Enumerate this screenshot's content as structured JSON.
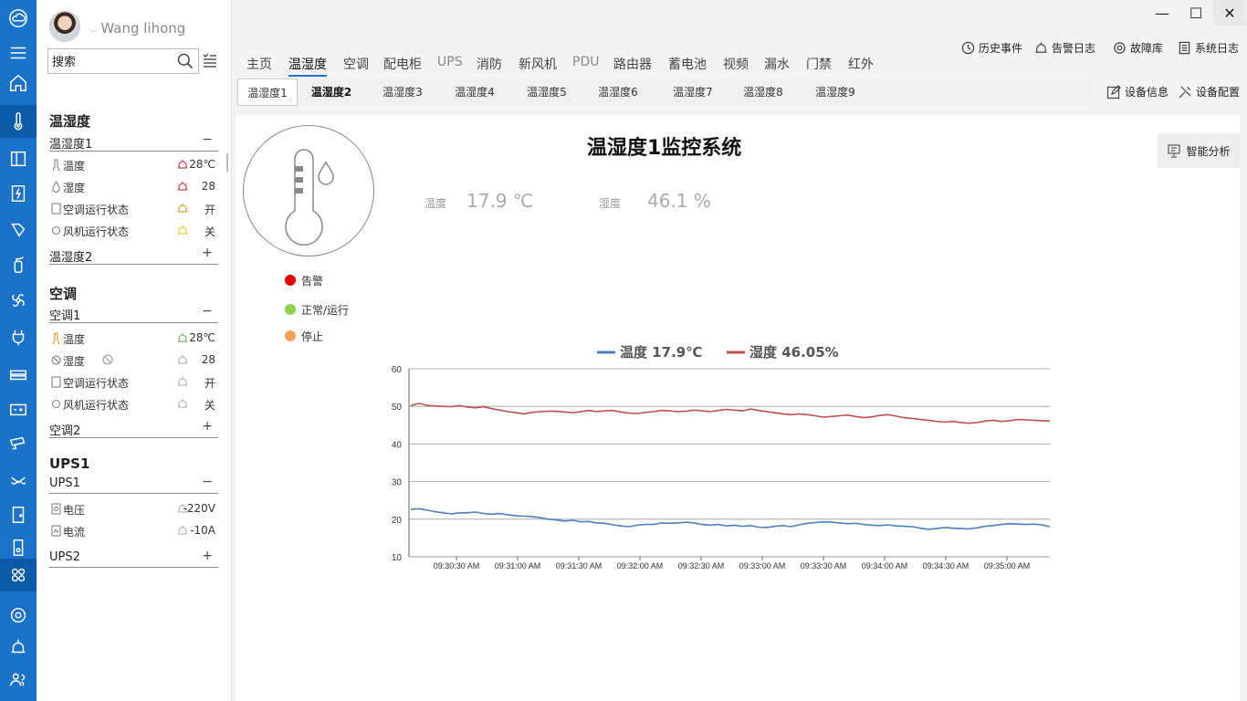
{
  "user": {
    "name": "Wang lihong"
  },
  "search": {
    "placeholder": "搜索"
  },
  "rail_icons": [
    "cloud-icon",
    "menu-icon",
    "home-icon",
    "thermometer-icon",
    "cabinet-icon",
    "power-icon",
    "fire-icon",
    "extinguisher-icon",
    "fan-icon",
    "plug-icon",
    "router-icon",
    "battery-icon",
    "camera-icon",
    "water-leak-icon",
    "door-icon",
    "ups-icon",
    "airflow-icon",
    "settings-icon",
    "alarm-icon",
    "users-icon"
  ],
  "tree": {
    "sections": [
      {
        "title": "温湿度",
        "groups": [
          {
            "name": "温湿度1",
            "toggle": "−",
            "rows": [
              {
                "label": "温度",
                "value": "28℃"
              },
              {
                "label": "湿度",
                "value": "28"
              },
              {
                "label": "空调运行状态",
                "value": "开"
              },
              {
                "label": "风机运行状态",
                "value": "关"
              }
            ]
          },
          {
            "name": "温湿度2",
            "toggle": "+"
          }
        ]
      },
      {
        "title": "空调",
        "groups": [
          {
            "name": "空调1",
            "toggle": "−",
            "rows": [
              {
                "label": "温度",
                "value": "28℃"
              },
              {
                "label": "湿度",
                "value": "28"
              },
              {
                "label": "空调运行状态",
                "value": "开"
              },
              {
                "label": "风机运行状态",
                "value": "关"
              }
            ]
          },
          {
            "name": "空调2",
            "toggle": "+"
          }
        ]
      },
      {
        "title": "UPS1",
        "groups": [
          {
            "name": "UPS1",
            "toggle": "−",
            "rows": [
              {
                "label": "电压",
                "value": "-220V"
              },
              {
                "label": "电流",
                "value": "-10A"
              }
            ]
          },
          {
            "name": "UPS2",
            "toggle": "+"
          }
        ]
      }
    ]
  },
  "window": {
    "minimize": "—",
    "maximize": "☐",
    "close": "✕"
  },
  "top_actions": {
    "history": "历史事件",
    "alarm_log": "告警日志",
    "fault_lib": "故障库",
    "sys_log": "系统日志"
  },
  "nav_tabs": [
    "主页",
    "温湿度",
    "空调",
    "配电柜",
    "UPS",
    "消防",
    "新风机",
    "PDU",
    "路由器",
    "蓄电池",
    "视频",
    "漏水",
    "门禁",
    "红外"
  ],
  "sub_tabs": [
    "温湿度1",
    "温湿度2",
    "温湿度3",
    "温湿度4",
    "温湿度5",
    "温湿度6",
    "温湿度7",
    "温湿度8",
    "温湿度9"
  ],
  "device": {
    "info": "设备信息",
    "config": "设备配置"
  },
  "panel": {
    "title": "温湿度1监控系统",
    "temp_label": "温度",
    "temp_value": "17.9 ℃",
    "hum_label": "湿度",
    "hum_value": "46.1 %",
    "smart_analysis": "智能分析",
    "status_legend": [
      {
        "label": "告警",
        "color": "#e60000"
      },
      {
        "label": "正常/运行",
        "color": "#8fd14f"
      },
      {
        "label": "停止",
        "color": "#f5a05a"
      }
    ]
  },
  "colors": {
    "accent": "#1a73c9",
    "temp_series": "#4a7fc1",
    "hum_series": "#c0504d",
    "alarm_red": "#c02020",
    "alarm_orange": "#e08a00",
    "alarm_yellow": "#d8c000",
    "alarm_green": "#5aa845",
    "alarm_gray": "#aaaaaa"
  },
  "chart_data": {
    "type": "line",
    "legend": [
      "温度  17.9℃",
      "湿度  46.05%"
    ],
    "ylim": [
      10,
      60
    ],
    "yticks": [
      10,
      20,
      30,
      40,
      50,
      60
    ],
    "xticks": [
      "09:30:30 AM",
      "09:31:00 AM",
      "09:31:30 AM",
      "09:32:00 AM",
      "09:32:30 AM",
      "09:33:00 AM",
      "09:33:30 AM",
      "09:34:00 AM",
      "09:34:30 AM",
      "09:35:00 AM"
    ],
    "series": [
      {
        "name": "温度",
        "color": "#4a7fc1",
        "values": [
          22.6,
          22.8,
          22.4,
          22.0,
          21.7,
          21.4,
          21.7,
          21.7,
          21.9,
          21.5,
          21.3,
          21.5,
          21.2,
          20.9,
          20.8,
          20.7,
          20.4,
          20.0,
          19.8,
          19.5,
          19.7,
          19.3,
          19.4,
          19.0,
          18.9,
          18.5,
          18.2,
          18.0,
          18.4,
          18.6,
          18.6,
          19.0,
          18.9,
          19.0,
          19.2,
          19.0,
          18.6,
          18.4,
          18.6,
          18.2,
          18.4,
          18.1,
          18.3,
          17.9,
          17.8,
          18.1,
          18.3,
          18.0,
          18.5,
          18.9,
          19.1,
          19.3,
          19.2,
          19.0,
          18.8,
          18.9,
          18.6,
          18.4,
          18.3,
          18.5,
          18.2,
          18.1,
          18.0,
          17.6,
          17.3,
          17.5,
          17.8,
          17.6,
          17.5,
          17.4,
          17.7,
          18.1,
          18.3,
          18.6,
          18.8,
          18.7,
          18.6,
          18.7,
          18.5,
          18.0
        ]
      },
      {
        "name": "湿度",
        "color": "#c0504d",
        "values": [
          50.2,
          50.8,
          50.3,
          50.1,
          50.0,
          49.9,
          50.2,
          49.8,
          49.6,
          49.9,
          49.4,
          49.0,
          48.6,
          48.3,
          48.0,
          48.4,
          48.6,
          48.7,
          48.7,
          48.5,
          48.3,
          48.6,
          48.9,
          48.6,
          48.8,
          48.9,
          48.5,
          48.2,
          48.1,
          48.4,
          48.6,
          48.9,
          48.8,
          48.6,
          48.7,
          49.0,
          48.8,
          48.6,
          48.9,
          49.2,
          49.0,
          48.8,
          49.3,
          48.9,
          48.6,
          48.3,
          48.0,
          47.8,
          48.0,
          47.8,
          47.5,
          47.1,
          47.3,
          47.5,
          47.7,
          47.3,
          47.0,
          47.2,
          47.6,
          47.8,
          47.4,
          47.0,
          46.8,
          46.5,
          46.3,
          46.0,
          45.8,
          46.0,
          45.7,
          45.5,
          45.7,
          46.1,
          46.3,
          46.0,
          46.2,
          46.5,
          46.4,
          46.3,
          46.2,
          46.1
        ]
      }
    ]
  }
}
